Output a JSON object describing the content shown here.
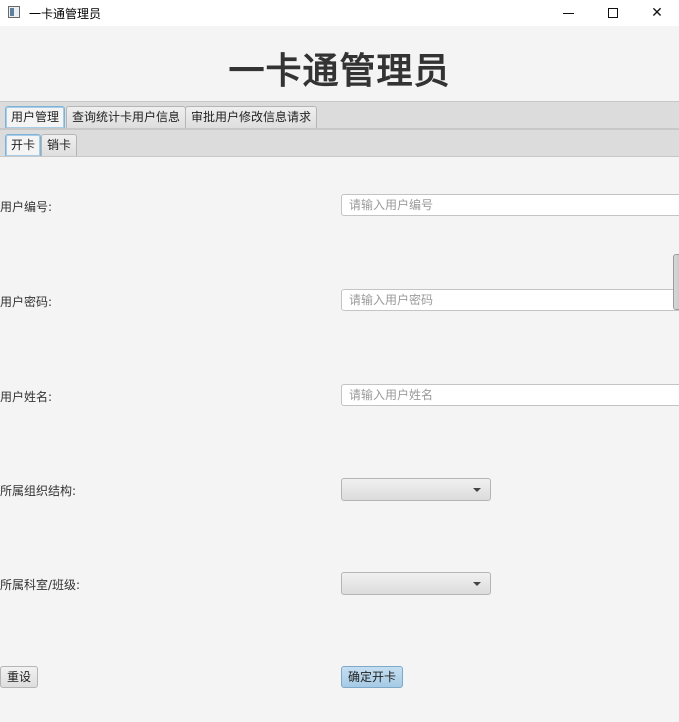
{
  "window": {
    "title": "一卡通管理员",
    "min_icon": "minimize-icon",
    "max_icon": "maximize-icon",
    "close_icon": "close-icon",
    "close_glyph": "✕"
  },
  "header": {
    "title": "一卡通管理员"
  },
  "main_tabs": [
    {
      "label": "用户管理",
      "selected": true
    },
    {
      "label": "查询统计卡用户信息",
      "selected": false
    },
    {
      "label": "审批用户修改信息请求",
      "selected": false
    }
  ],
  "sub_tabs": [
    {
      "label": "开卡",
      "selected": true
    },
    {
      "label": "销卡",
      "selected": false
    }
  ],
  "form": {
    "user_id": {
      "label": "用户编号:",
      "placeholder": "请输入用户编号",
      "value": ""
    },
    "password": {
      "label": "用户密码:",
      "placeholder": "请输入用户密码",
      "value": ""
    },
    "name": {
      "label": "用户姓名:",
      "placeholder": "请输入用户姓名",
      "value": ""
    },
    "org": {
      "label": "所属组织结构:",
      "selected": ""
    },
    "dept": {
      "label": "所属科室/班级:",
      "selected": ""
    }
  },
  "buttons": {
    "reset": "重设",
    "confirm": "确定开卡"
  },
  "colors": {
    "accent": "#a6cbe6",
    "tab_selected_border": "#7fb2d7",
    "background": "#f4f4f4"
  }
}
